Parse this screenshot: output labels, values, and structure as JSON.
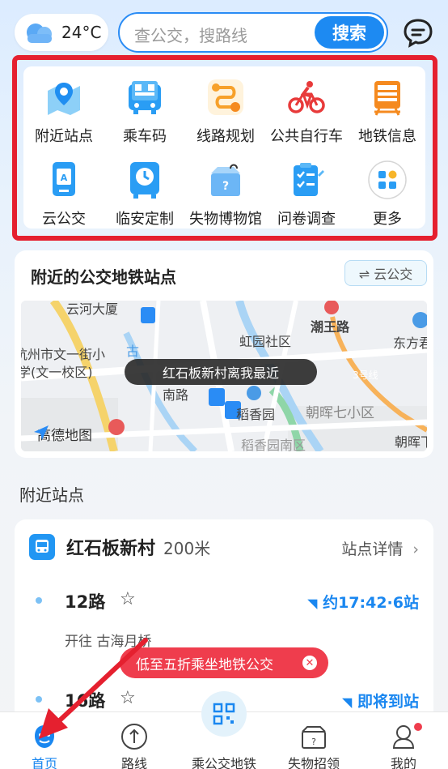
{
  "weather": {
    "temperature": "24°C",
    "icon": "cloud-icon"
  },
  "search": {
    "placeholder": "查公交，搜路线",
    "button": "搜索"
  },
  "header": {
    "message_icon": "chat-icon"
  },
  "grid": [
    {
      "label": "附近站点",
      "icon": "map-pin-icon"
    },
    {
      "label": "乘车码",
      "icon": "qr-bus-icon"
    },
    {
      "label": "线路规划",
      "icon": "route-icon"
    },
    {
      "label": "公共自行车",
      "icon": "bicycle-icon"
    },
    {
      "label": "地铁信息",
      "icon": "subway-icon"
    },
    {
      "label": "云公交",
      "icon": "cloud-bus-icon"
    },
    {
      "label": "临安定制",
      "icon": "clock-bus-icon"
    },
    {
      "label": "失物博物馆",
      "icon": "lost-box-icon"
    },
    {
      "label": "问卷调查",
      "icon": "clipboard-icon"
    },
    {
      "label": "更多",
      "icon": "more-icon"
    }
  ],
  "nearby_map": {
    "title": "附近的公交地铁站点",
    "cloud_bus_button": "⇌ 云公交",
    "bubble": "红石板新村离我最近",
    "map_logo": "高德地图",
    "map_labels": [
      "云河大厦",
      "虹园社区",
      "潮王路",
      "东方君",
      "杭州市文一街小",
      "学(文一校区)",
      "古",
      "南路",
      "朝晖七小区",
      "稻香园",
      "稻香园南区",
      "3号线",
      "朝晖下"
    ]
  },
  "nearby_stations": {
    "section_title": "附近站点",
    "station_name": "红石板新村",
    "distance": "200米",
    "detail_link": "站点详情",
    "routes": [
      {
        "name": "12路",
        "arrival": "约17:42·6站",
        "toward": "开往 古海月桥"
      },
      {
        "name": "16路",
        "arrival": "即将到站",
        "toward": ""
      }
    ]
  },
  "promo": {
    "text": "低至五折乘坐地铁公交"
  },
  "bottom_nav": [
    {
      "label": "首页",
      "active": true
    },
    {
      "label": "路线",
      "active": false
    },
    {
      "label": "乘公交地铁",
      "active": false
    },
    {
      "label": "失物招领",
      "active": false
    },
    {
      "label": "我的",
      "active": false
    }
  ],
  "colors": {
    "accent": "#1d8af2",
    "highlight_border": "#e5202f",
    "promo": "#ef3d4d"
  }
}
